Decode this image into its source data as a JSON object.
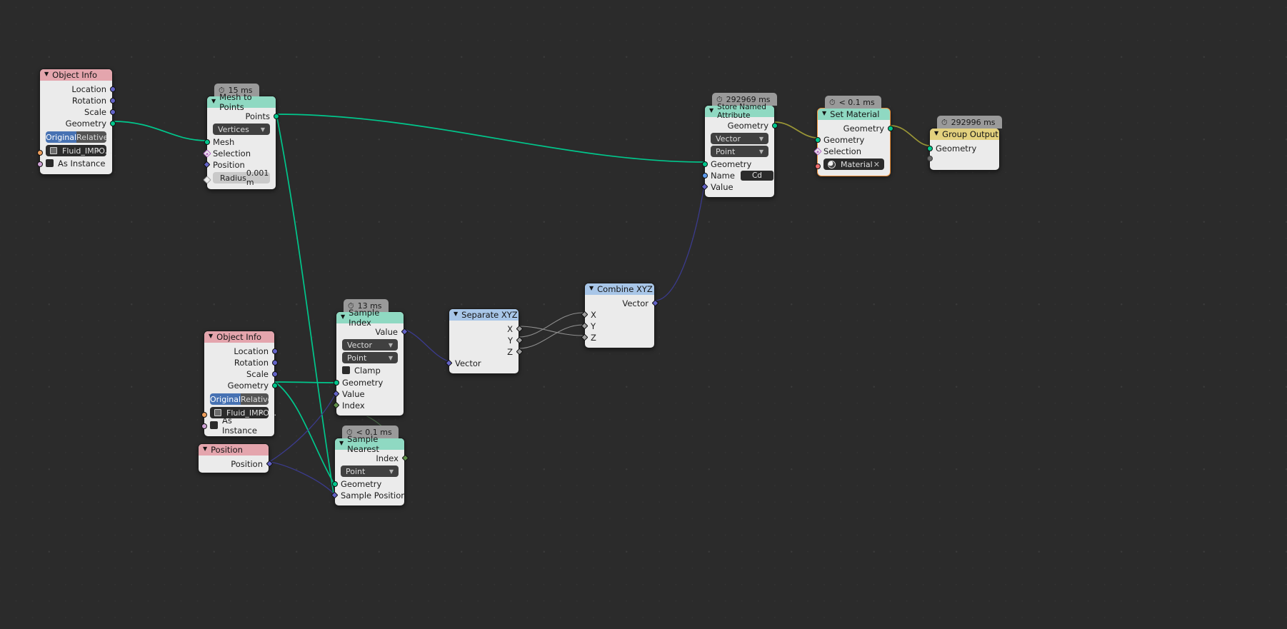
{
  "editor": {
    "name": "blender-geometry-nodes-editor",
    "background": "#2b2b2b"
  },
  "colors": {
    "header_geometry": "#8fd9c2",
    "header_input": "#e4a5ad",
    "header_vector": "#a8c6e8",
    "header_output": "#e3d17e",
    "node_body": "#ebebeb",
    "selected_outline": "#ed8f3a",
    "wire_geometry": "#00c78c",
    "wire_material": "#9a9636",
    "wire_vector": "#3b3b8c",
    "wire_field": "#6e7a6e"
  },
  "icons": {
    "clock": "clock-icon",
    "collapse": "chevron-down-icon",
    "dropdown": "chevron-down-icon",
    "close": "close-icon"
  },
  "nodes": [
    {
      "id": "object-info-1",
      "title": "Object Info",
      "timer": null,
      "outputs": [
        "Location",
        "Rotation",
        "Scale",
        "Geometry"
      ],
      "toggle": {
        "left": "Original",
        "right": "Relative",
        "active": "Original"
      },
      "object_field": "Fluid_IMPO...",
      "as_instance": "As Instance"
    },
    {
      "id": "mesh-to-points",
      "title": "Mesh to Points",
      "timer": "15 ms",
      "outputs": [
        "Points"
      ],
      "mode": "Vertices",
      "inputs": [
        "Mesh",
        "Selection",
        "Position"
      ],
      "radius_label": "Radius",
      "radius_value": "0.001 m"
    },
    {
      "id": "object-info-2",
      "title": "Object Info",
      "timer": null,
      "outputs": [
        "Location",
        "Rotation",
        "Scale",
        "Geometry"
      ],
      "toggle": {
        "left": "Original",
        "right": "Relative",
        "active": "Original"
      },
      "object_field": "Fluid_IMPO...",
      "as_instance": "As Instance"
    },
    {
      "id": "position",
      "title": "Position",
      "timer": null,
      "outputs": [
        "Position"
      ]
    },
    {
      "id": "sample-index",
      "title": "Sample Index",
      "timer": "13 ms",
      "outputs": [
        "Value"
      ],
      "data_type": "Vector",
      "domain": "Point",
      "clamp_label": "Clamp",
      "inputs": [
        "Geometry",
        "Value",
        "Index"
      ]
    },
    {
      "id": "sample-nearest",
      "title": "Sample Nearest",
      "timer": "< 0.1 ms",
      "outputs": [
        "Index"
      ],
      "domain": "Point",
      "inputs": [
        "Geometry",
        "Sample Position"
      ]
    },
    {
      "id": "separate-xyz",
      "title": "Separate XYZ",
      "timer": null,
      "outputs": [
        "X",
        "Y",
        "Z"
      ],
      "inputs": [
        "Vector"
      ]
    },
    {
      "id": "combine-xyz",
      "title": "Combine XYZ",
      "timer": null,
      "outputs": [
        "Vector"
      ],
      "inputs": [
        "X",
        "Y",
        "Z"
      ]
    },
    {
      "id": "store-named-attribute",
      "title": "Store Named Attribute",
      "timer": "292969 ms",
      "outputs": [
        "Geometry"
      ],
      "data_type": "Vector",
      "domain": "Point",
      "inputs": [
        "Geometry",
        "Name",
        "Value"
      ],
      "name_value": "Cd"
    },
    {
      "id": "set-material",
      "title": "Set Material",
      "timer": "< 0.1 ms",
      "selected": true,
      "outputs": [
        "Geometry"
      ],
      "inputs": [
        "Geometry",
        "Selection"
      ],
      "material_field": "Material"
    },
    {
      "id": "group-output",
      "title": "Group Output",
      "timer": "292996 ms",
      "inputs": [
        "Geometry"
      ]
    }
  ]
}
